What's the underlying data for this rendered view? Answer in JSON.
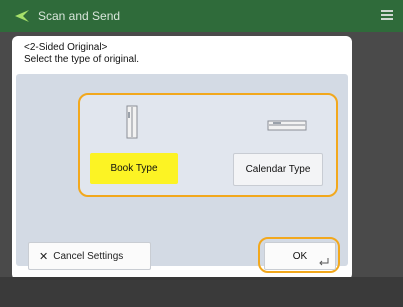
{
  "header": {
    "title": "Scan and Send"
  },
  "dialog": {
    "line1": "<2-Sided Original>",
    "line2": "Select the type of original."
  },
  "options": [
    {
      "label": "Book Type",
      "selected": true
    },
    {
      "label": "Calendar Type",
      "selected": false
    }
  ],
  "buttons": {
    "cancel": "Cancel Settings",
    "ok": "OK"
  },
  "icons": {
    "back": "arrow-back-icon",
    "menu": "menu-icon",
    "book": "book-type-icon",
    "calendar": "calendar-type-icon",
    "cancel": "close-icon",
    "ok": "enter-icon"
  },
  "colors": {
    "header_bg": "#2f6b3a",
    "selected_yellow": "#fcf324",
    "focus_orange": "#f2a81d"
  }
}
